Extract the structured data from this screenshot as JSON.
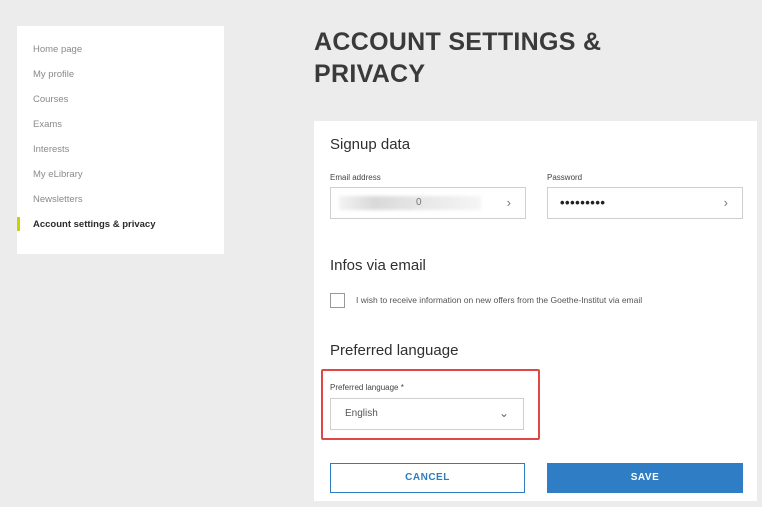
{
  "sidebar": {
    "items": [
      {
        "label": "Home page"
      },
      {
        "label": "My profile"
      },
      {
        "label": "Courses"
      },
      {
        "label": "Exams"
      },
      {
        "label": "Interests"
      },
      {
        "label": "My eLibrary"
      },
      {
        "label": "Newsletters"
      },
      {
        "label": "Account settings & privacy",
        "active": true
      }
    ]
  },
  "page": {
    "title": "ACCOUNT SETTINGS & PRIVACY"
  },
  "signup": {
    "title": "Signup data",
    "email_label": "Email address",
    "email_value": "0",
    "password_label": "Password",
    "password_value": "•••••••••"
  },
  "infos": {
    "title": "Infos via email",
    "checkbox_label": "I wish to receive information on new offers from the Goethe-Institut via email",
    "checked": false
  },
  "language": {
    "title": "Preferred language",
    "field_label": "Preferred language *",
    "selected": "English"
  },
  "actions": {
    "cancel_label": "CANCEL",
    "save_label": "SAVE"
  },
  "colors": {
    "accent": "#2f7dc4",
    "active_marker": "#c6d400",
    "highlight": "#e04848",
    "background": "#ececec"
  },
  "icons": {
    "field_chevron": "chevron-right-icon",
    "select_chevron": "chevron-down-icon"
  }
}
